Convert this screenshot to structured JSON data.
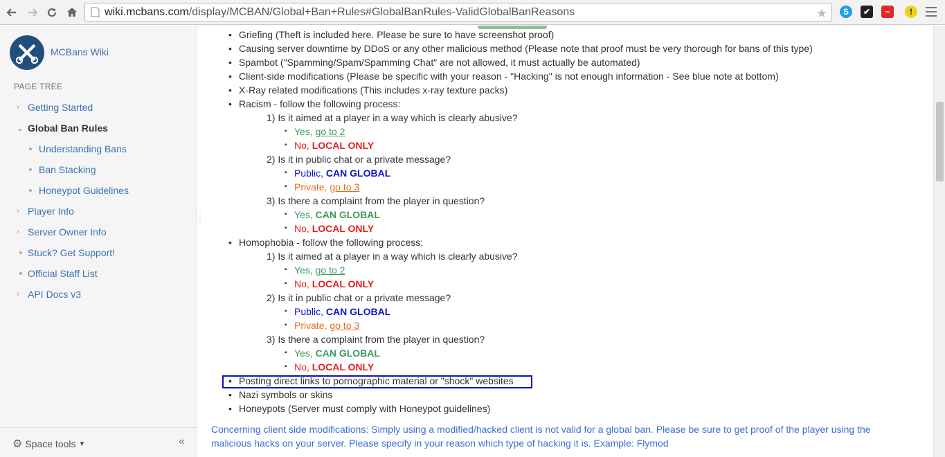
{
  "browser": {
    "url_host": "wiki.mcbans.com",
    "url_path": "/display/MCBAN/Global+Ban+Rules#GlobalBanRules-ValidGlobalBanReasons"
  },
  "sidebar": {
    "space_name": "MCBans Wiki",
    "tree_title": "PAGE TREE",
    "items": [
      {
        "label": "Getting Started"
      },
      {
        "label": "Global Ban Rules"
      },
      {
        "label": "Understanding Bans"
      },
      {
        "label": "Ban Stacking"
      },
      {
        "label": "Honeypot Guidelines"
      },
      {
        "label": "Player Info"
      },
      {
        "label": "Server Owner Info"
      },
      {
        "label": "Stuck? Get Support!"
      },
      {
        "label": "Official Staff List"
      },
      {
        "label": "API Docs v3"
      }
    ],
    "space_tools": "Space tools",
    "collapse": "«"
  },
  "content": {
    "items": [
      "Griefing (Theft is included here. Please be sure to have screenshot proof)",
      "Causing server downtime by DDoS or any other malicious method (Please note that proof must be very thorough for bans of this type)",
      "Spambot (\"Spamming/Spam/Spamming Chat\" are not allowed, it must actually be automated)",
      "Client-side modifications (Please be specific with your reason - \"Hacking\" is not enough information - See blue note at bottom)",
      "X-Ray related modifications (This includes x-ray texture packs)",
      "Racism - follow the following process:",
      "Homophobia - follow the following process:",
      "Posting direct links to pornographic material or \"shock\" websites",
      "Nazi symbols or skins",
      "Honeypots (Server must comply with Honeypot guidelines)"
    ],
    "q1": "1) Is it aimed at a player in a way which is clearly abusive?",
    "q2": "2) Is it in public chat or a private message?",
    "q3": "3) Is there a complaint from the player in question?",
    "yes": "Yes, ",
    "no": "No, ",
    "public": "Public, ",
    "private": "Private, ",
    "goto2": "go to 2",
    "goto3": "go to 3",
    "local_only": "LOCAL ONLY",
    "can_global": "CAN GLOBAL",
    "note_line1": "Concerning client side modifications: Simply using a modified/hacked client is not valid for a global ban. Please be sure to get proof of the player using the",
    "note_line2": "malicious hacks on your server. Please specify in your reason which type of hacking it is. Example: Flymod"
  }
}
